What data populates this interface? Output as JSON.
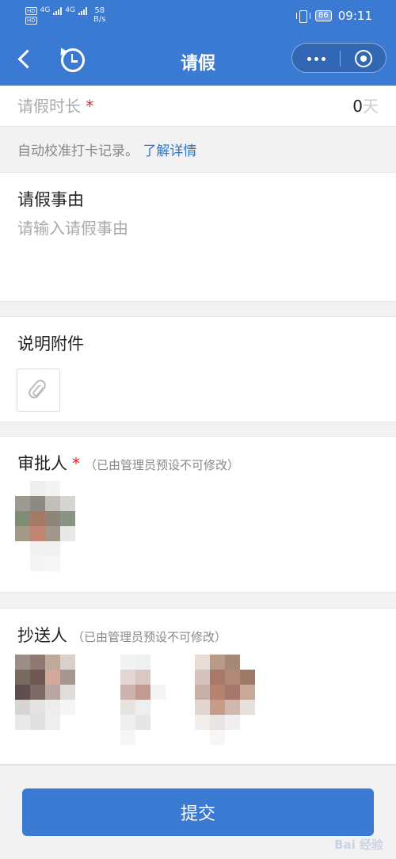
{
  "status_bar": {
    "net_label": "HD",
    "net_type": "4G",
    "speed_value": "58",
    "speed_unit": "B/s",
    "battery": "86",
    "time": "09:11"
  },
  "navbar": {
    "title": "请假",
    "back_icon": "back-arrow-icon",
    "history_icon": "history-icon",
    "more_icon": "more-dots-icon",
    "close_icon": "target-close-icon"
  },
  "form": {
    "duration": {
      "label": "请假时长",
      "required_mark": "*",
      "value": "0",
      "unit": "天"
    },
    "note": {
      "text": "自动校准打卡记录。",
      "link": "了解详情"
    },
    "reason": {
      "label": "请假事由",
      "placeholder": "请输入请假事由",
      "value": ""
    },
    "attachment": {
      "label": "说明附件",
      "icon": "paperclip-icon"
    },
    "approver": {
      "label": "审批人",
      "required_mark": "*",
      "hint": "（已由管理员预设不可修改）"
    },
    "cc": {
      "label": "抄送人",
      "hint": "（已由管理员预设不可修改）"
    }
  },
  "submit_label": "提交",
  "watermark": "Bai 经验",
  "colors": {
    "brand": "#3a7ad3",
    "required": "#e22222",
    "link": "#2f74c9"
  }
}
